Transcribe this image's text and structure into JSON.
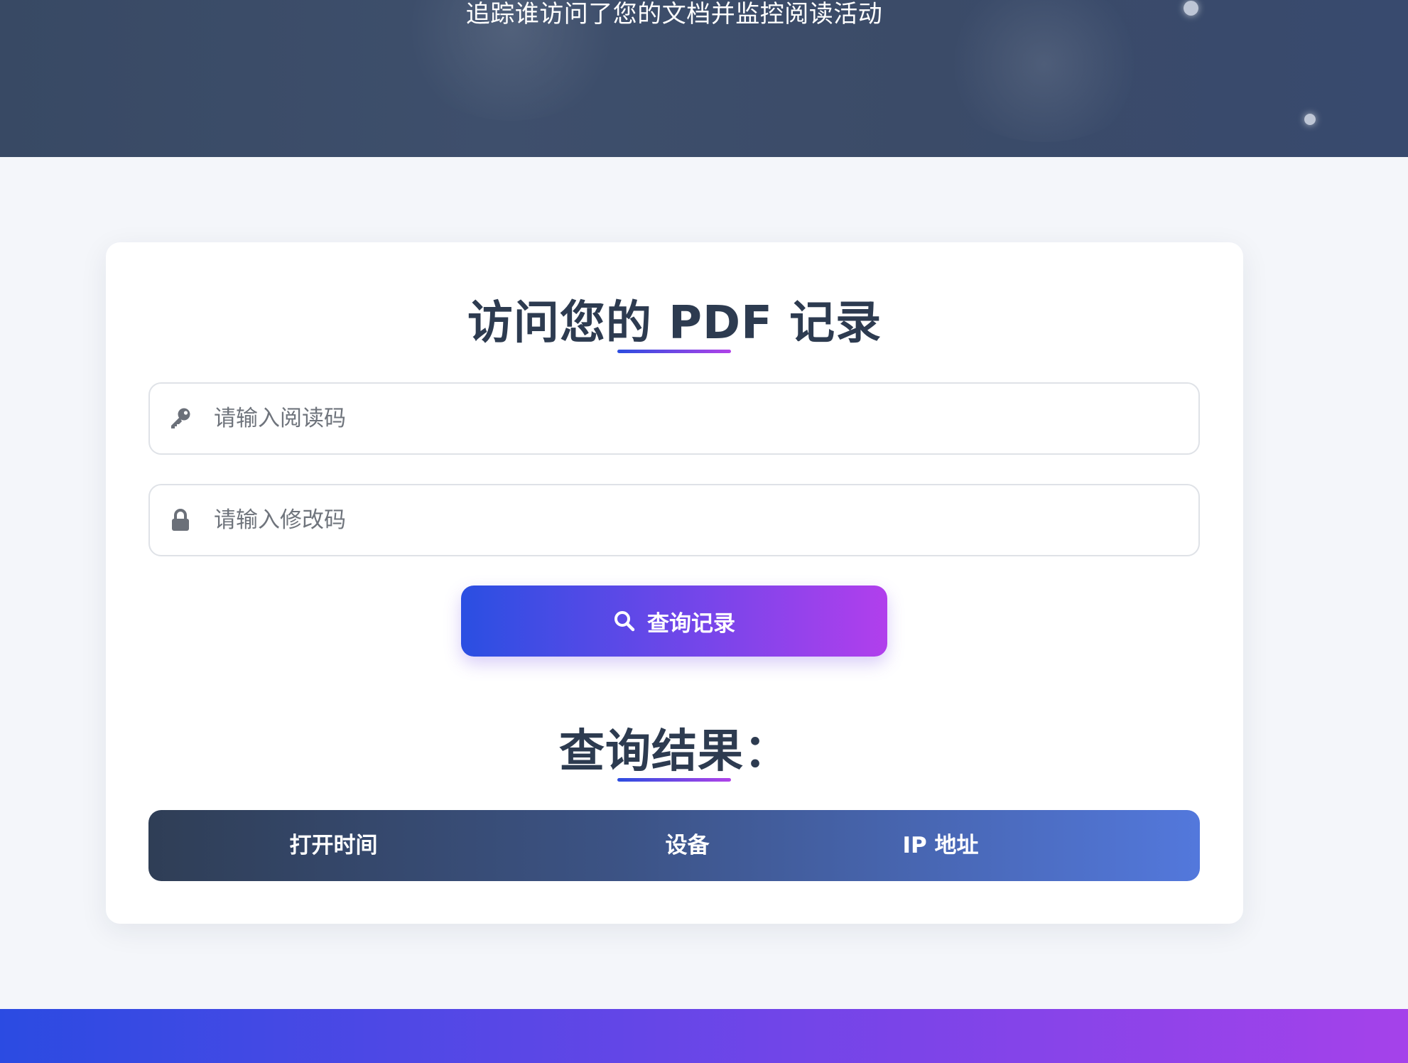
{
  "hero": {
    "subtitle": "追踪谁访问了您的文档并监控阅读活动"
  },
  "access_form": {
    "title": "访问您的 PDF 记录",
    "read_code": {
      "placeholder": "请输入阅读码",
      "value": "",
      "icon": "key-icon"
    },
    "edit_code": {
      "placeholder": "请输入修改码",
      "value": "",
      "icon": "lock-icon"
    },
    "submit_label": "查询记录",
    "submit_icon": "search-icon"
  },
  "results": {
    "title": "查询结果：",
    "columns": [
      "打开时间",
      "设备",
      "IP 地址"
    ],
    "rows": []
  },
  "colors": {
    "accent_start": "#2a4fe2",
    "accent_end": "#b13fec",
    "heading": "#2d3b50",
    "hero_bg": "#3b4b68"
  }
}
